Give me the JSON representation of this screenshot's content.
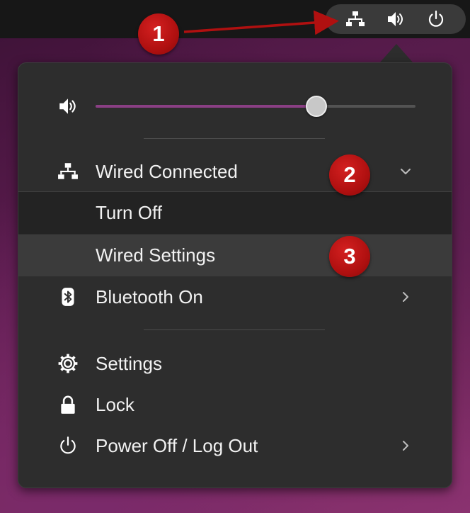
{
  "topbar": {
    "tray_icons": [
      "network-wired-icon",
      "volume-icon",
      "power-icon"
    ]
  },
  "volume": {
    "icon": "volume-icon",
    "level_fraction": 0.69,
    "fill_color": "#8a3f84"
  },
  "network": {
    "icon": "network-wired-icon",
    "label": "Wired Connected",
    "expanded": true,
    "submenu": [
      {
        "label": "Turn Off"
      },
      {
        "label": "Wired Settings",
        "highlighted": true
      }
    ]
  },
  "bluetooth": {
    "icon": "bluetooth-icon",
    "label": "Bluetooth On"
  },
  "settings": {
    "icon": "gear-icon",
    "label": "Settings"
  },
  "lock": {
    "icon": "lock-icon",
    "label": "Lock"
  },
  "power": {
    "icon": "power-icon",
    "label": "Power Off / Log Out"
  },
  "callouts": [
    "1",
    "2",
    "3"
  ],
  "colors": {
    "menu_bg": "#2d2d2d",
    "topbar_bg": "#171717",
    "callout_red": "#b01010",
    "accent_purple": "#8a3f84"
  }
}
